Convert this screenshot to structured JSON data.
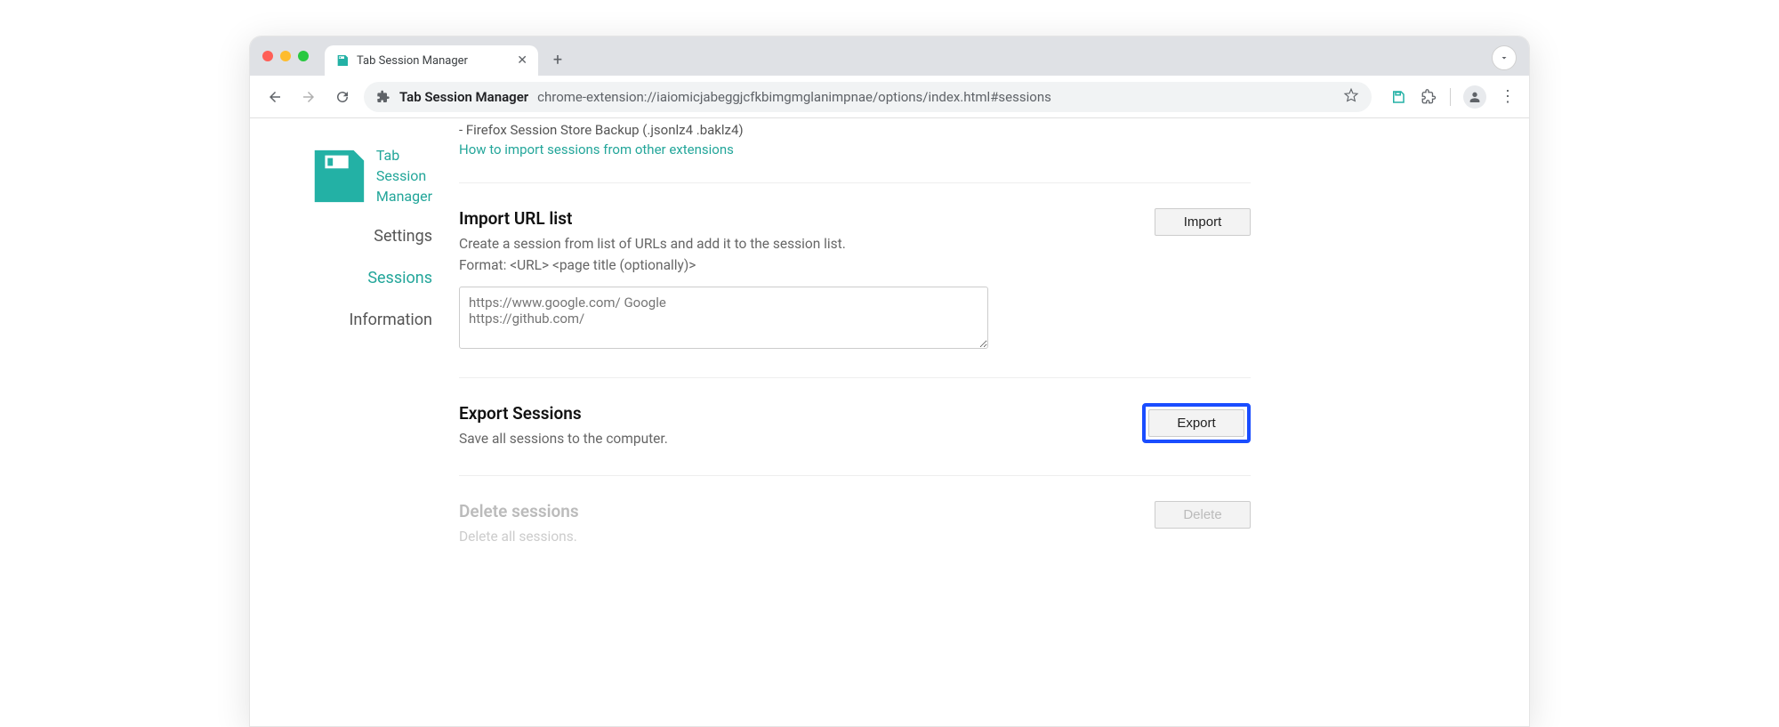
{
  "browser": {
    "tab_title": "Tab Session Manager",
    "site_label": "Tab Session Manager",
    "url": "chrome-extension://iaiomicjabeggjcfkbimgmglanimpnae/options/index.html#sessions"
  },
  "sidebar": {
    "app_name": "Tab\nSession\nManager",
    "items": [
      {
        "label": "Settings"
      },
      {
        "label": "Sessions"
      },
      {
        "label": "Information"
      }
    ]
  },
  "partial": {
    "backup_line": "- Firefox Session Store Backup (.jsonlz4 .baklz4)",
    "link": "How to import sessions from other extensions"
  },
  "import_url": {
    "title": "Import URL list",
    "desc1": "Create a session from list of URLs and add it to the session list.",
    "desc2": "Format: <URL> <page title (optionally)>",
    "placeholder": "https://www.google.com/ Google\nhttps://github.com/",
    "button": "Import"
  },
  "export": {
    "title": "Export Sessions",
    "desc": "Save all sessions to the computer.",
    "button": "Export"
  },
  "delete": {
    "title": "Delete sessions",
    "desc": "Delete all sessions.",
    "button": "Delete"
  }
}
